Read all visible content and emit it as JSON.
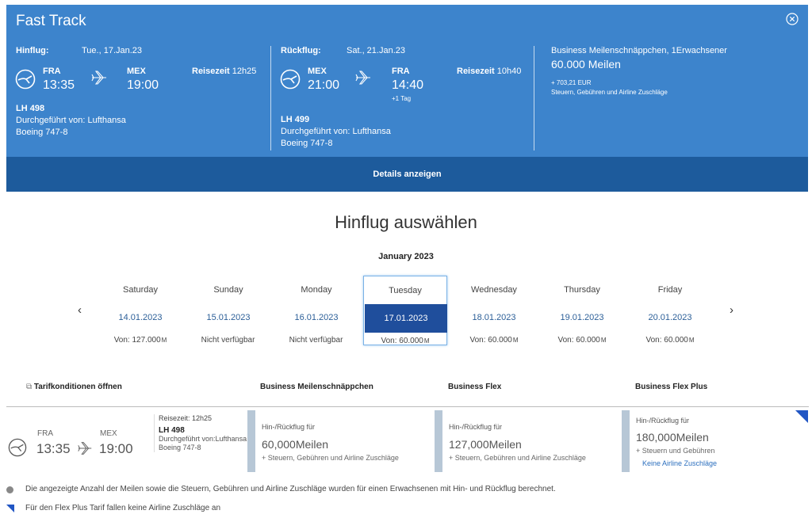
{
  "panel": {
    "title": "Fast Track",
    "outbound": {
      "heading": "Hinflug:",
      "date": "Tue., 17.Jan.23",
      "from_code": "FRA",
      "from_time": "13:35",
      "to_code": "MEX",
      "to_time": "19:00",
      "duration_label": "Reisezeit",
      "duration": "12h25",
      "flight": "LH 498",
      "operator": "Durchgeführt von: Lufthansa",
      "aircraft": "Boeing 747-8"
    },
    "return": {
      "heading": "Rückflug:",
      "date": "Sat., 21.Jan.23",
      "from_code": "MEX",
      "from_time": "21:00",
      "to_code": "FRA",
      "to_time": "14:40",
      "next_day": "+1 Tag",
      "duration_label": "Reisezeit",
      "duration": "10h40",
      "flight": "LH 499",
      "operator": "Durchgeführt von: Lufthansa",
      "aircraft": "Boeing 747-8"
    },
    "summary": {
      "fare": "Business Meilenschnäppchen, 1Erwachsener",
      "miles": "60.000 Meilen",
      "tax": "+ 703,21 EUR",
      "tax_note": "Steuern, Gebühren und Airline Zuschläge"
    },
    "details_label": "Details anzeigen"
  },
  "selection": {
    "heading": "Hinflug auswählen",
    "month": "January 2023",
    "days": [
      {
        "name": "Saturday",
        "date": "14.01.2023",
        "price": "Von: 127.000",
        "unit": "M"
      },
      {
        "name": "Sunday",
        "date": "15.01.2023",
        "price": "Nicht verfügbar",
        "unit": ""
      },
      {
        "name": "Monday",
        "date": "16.01.2023",
        "price": "Nicht verfügbar",
        "unit": ""
      },
      {
        "name": "Tuesday",
        "date": "17.01.2023",
        "price": "Von: 60.000",
        "unit": "M"
      },
      {
        "name": "Wednesday",
        "date": "18.01.2023",
        "price": "Von: 60.000",
        "unit": "M"
      },
      {
        "name": "Thursday",
        "date": "19.01.2023",
        "price": "Von: 60.000",
        "unit": "M"
      },
      {
        "name": "Friday",
        "date": "20.01.2023",
        "price": "Von: 60.000",
        "unit": "M"
      }
    ],
    "selected_day": "Tuesday"
  },
  "fares": {
    "conditions_link": "Tarifkonditionen öffnen",
    "columns": [
      "Business Meilenschnäppchen",
      "Business Flex",
      "Business Flex Plus"
    ],
    "flight": {
      "from_code": "FRA",
      "from_time": "13:35",
      "to_code": "MEX",
      "to_time": "19:00",
      "duration": "Reisezeit: 12h25",
      "number": "LH 498",
      "operator": "Durchgeführt von:Lufthansa",
      "aircraft": "Boeing 747-8"
    },
    "options": [
      {
        "label": "Hin-/Rückflug für",
        "miles": "60,000Meilen",
        "note": "+ Steuern, Gebühren und Airline Zuschläge",
        "extra": ""
      },
      {
        "label": "Hin-/Rückflug für",
        "miles": "127,000Meilen",
        "note": "+ Steuern, Gebühren und Airline Zuschläge",
        "extra": ""
      },
      {
        "label": "Hin-/Rückflug für",
        "miles": "180,000Meilen",
        "note": "+ Steuern und Gebühren",
        "extra": "Keine Airline Zuschläge"
      }
    ]
  },
  "notes": [
    "Die angezeigte Anzahl der Meilen sowie die Steuern, Gebühren und Airline Zuschläge wurden für einen Erwachsenen mit Hin- und Rückflug berechnet.",
    "Für den Flex Plus Tarif fallen keine Airline Zuschläge an"
  ],
  "colors": {
    "panel": "#3d84cc",
    "details_bar": "#1d5b9c",
    "selected": "#1f4e9c",
    "corner": "#2156c4"
  },
  "icons": [
    "close-circle-icon",
    "lufthansa-crane-icon",
    "airplane-icon",
    "chevron-left-icon",
    "chevron-right-icon",
    "external-link-icon",
    "corner-flag-icon",
    "info-dot-icon"
  ]
}
